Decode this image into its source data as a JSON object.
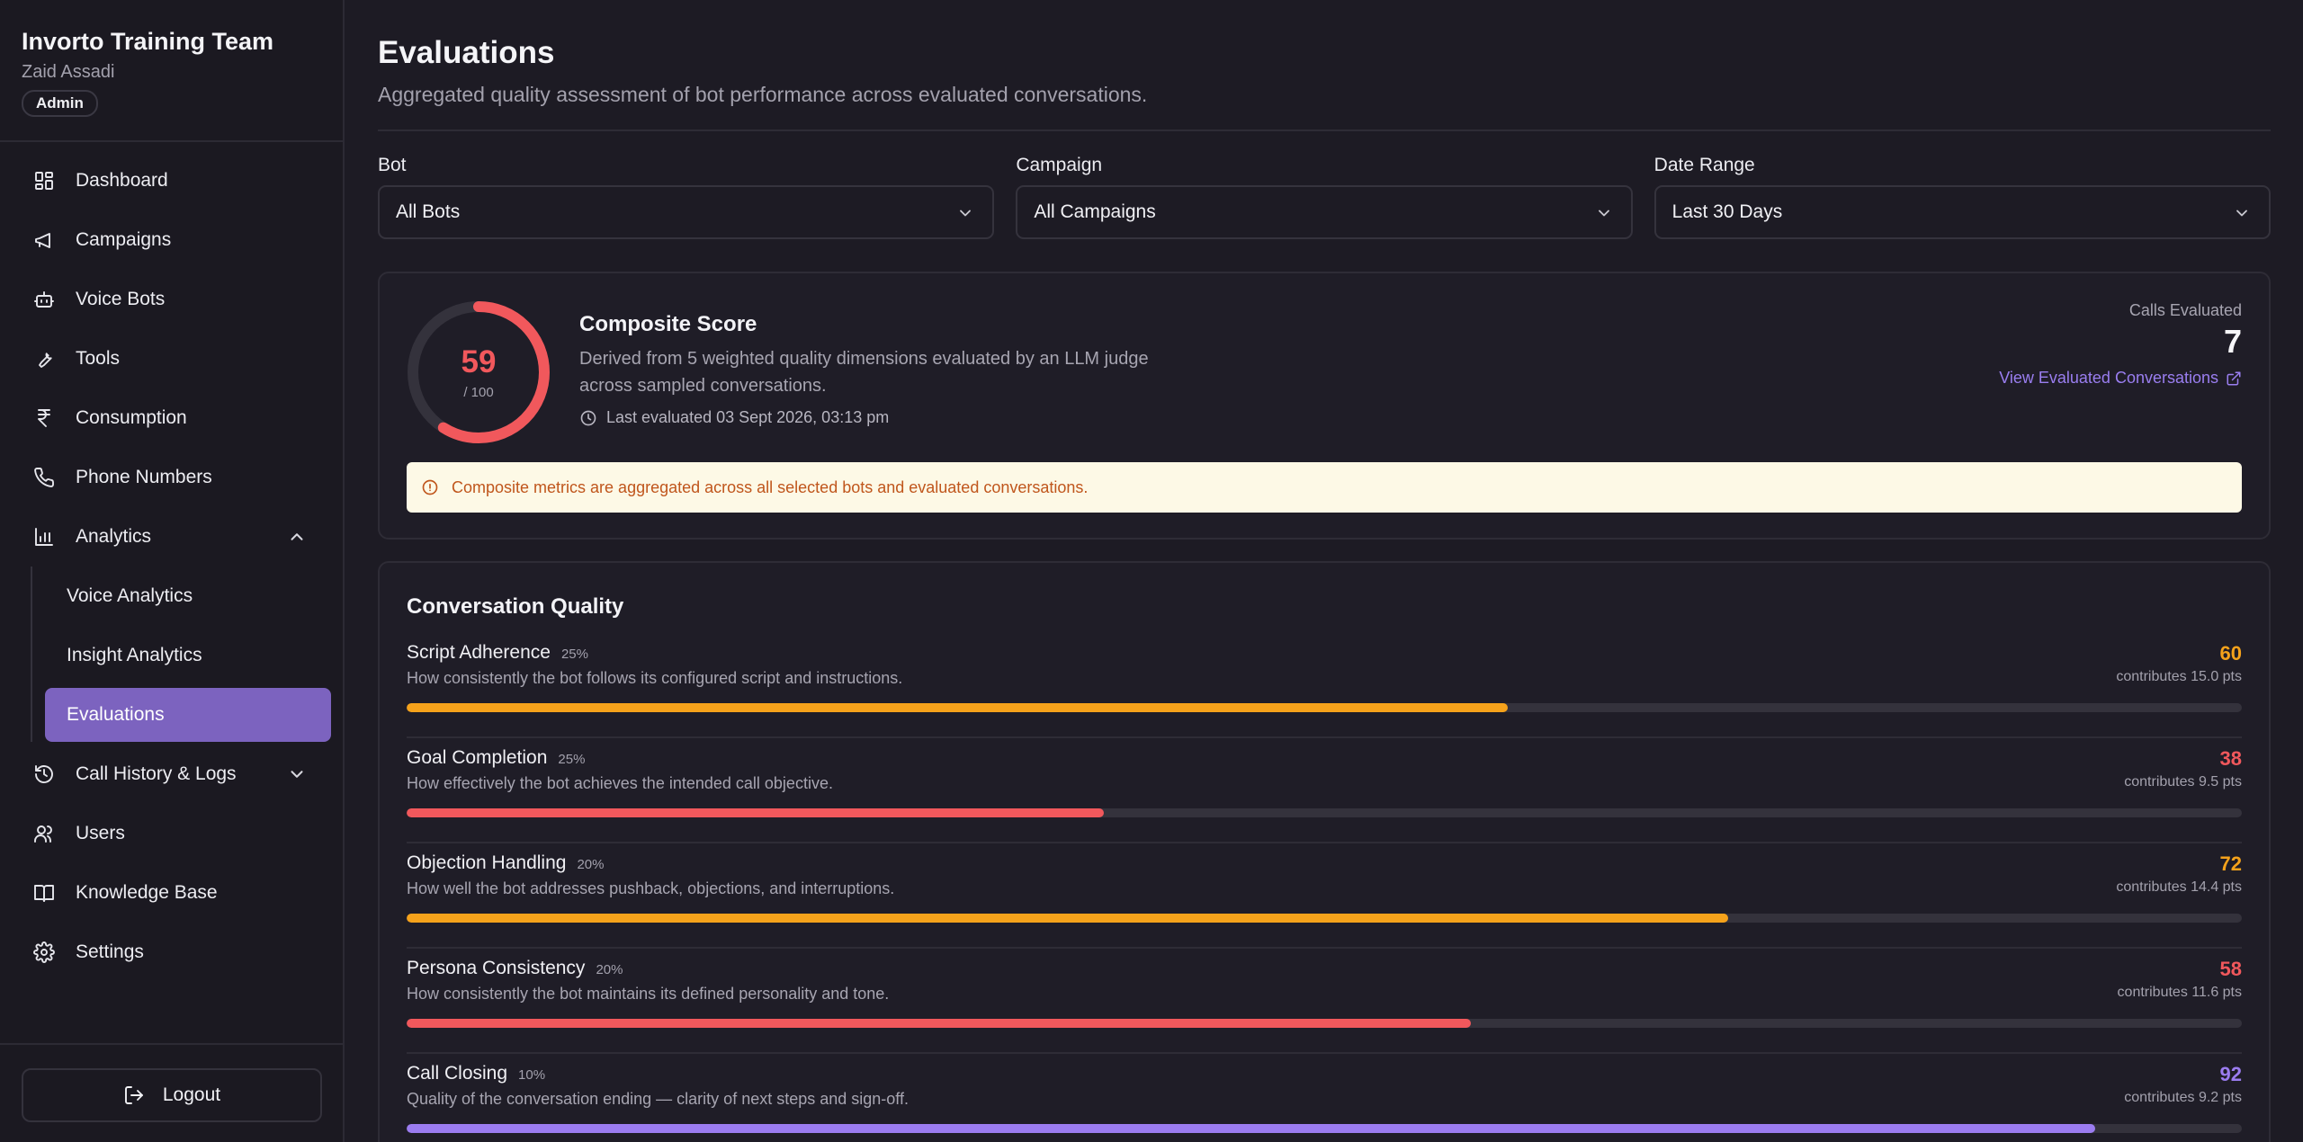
{
  "sidebar": {
    "org_name": "Invorto Training Team",
    "user_name": "Zaid Assadi",
    "role": "Admin",
    "items": [
      {
        "label": "Dashboard",
        "icon": "dashboard-icon"
      },
      {
        "label": "Campaigns",
        "icon": "megaphone-icon"
      },
      {
        "label": "Voice Bots",
        "icon": "bot-icon"
      },
      {
        "label": "Tools",
        "icon": "wrench-icon"
      },
      {
        "label": "Consumption",
        "icon": "rupee-icon"
      },
      {
        "label": "Phone Numbers",
        "icon": "phone-icon"
      },
      {
        "label": "Analytics",
        "icon": "bar-chart-icon",
        "expanded": true
      },
      {
        "label": "Call History & Logs",
        "icon": "history-icon",
        "expanded": false
      },
      {
        "label": "Users",
        "icon": "users-icon"
      },
      {
        "label": "Knowledge Base",
        "icon": "book-icon"
      },
      {
        "label": "Settings",
        "icon": "gear-icon"
      }
    ],
    "analytics_sub": [
      {
        "label": "Voice Analytics"
      },
      {
        "label": "Insight Analytics"
      },
      {
        "label": "Evaluations",
        "active": true
      }
    ],
    "logout_label": "Logout"
  },
  "header": {
    "title": "Evaluations",
    "subtitle": "Aggregated quality assessment of bot performance across evaluated conversations."
  },
  "filters": [
    {
      "label": "Bot",
      "value": "All Bots"
    },
    {
      "label": "Campaign",
      "value": "All Campaigns"
    },
    {
      "label": "Date Range",
      "value": "Last 30 Days"
    }
  ],
  "composite": {
    "score": 59,
    "max_label": "/ 100",
    "title": "Composite Score",
    "description": "Derived from 5 weighted quality dimensions evaluated by an LLM judge across sampled conversations.",
    "last_evaluated": "Last evaluated 03 Sept 2026, 03:13 pm",
    "calls_label": "Calls Evaluated",
    "calls_value": "7",
    "view_link": "View Evaluated Conversations",
    "notice": "Composite metrics are aggregated across all selected bots and evaluated conversations.",
    "ring_color": "#f1585c"
  },
  "quality": {
    "title": "Conversation Quality",
    "dimensions": [
      {
        "name": "Script Adherence",
        "weight": "25%",
        "desc": "How consistently the bot follows its configured script and instructions.",
        "score": "60",
        "contrib": "contributes 15.0 pts",
        "value": 60,
        "color": "#f5a21b"
      },
      {
        "name": "Goal Completion",
        "weight": "25%",
        "desc": "How effectively the bot achieves the intended call objective.",
        "score": "38",
        "contrib": "contributes 9.5 pts",
        "value": 38,
        "color": "#f1585c"
      },
      {
        "name": "Objection Handling",
        "weight": "20%",
        "desc": "How well the bot addresses pushback, objections, and interruptions.",
        "score": "72",
        "contrib": "contributes 14.4 pts",
        "value": 72,
        "color": "#f5a21b"
      },
      {
        "name": "Persona Consistency",
        "weight": "20%",
        "desc": "How consistently the bot maintains its defined personality and tone.",
        "score": "58",
        "contrib": "contributes 11.6 pts",
        "value": 58,
        "color": "#f1585c"
      },
      {
        "name": "Call Closing",
        "weight": "10%",
        "desc": "Quality of the conversation ending — clarity of next steps and sign-off.",
        "score": "92",
        "contrib": "contributes 9.2 pts",
        "value": 92,
        "color": "#9b7cf0"
      }
    ]
  }
}
